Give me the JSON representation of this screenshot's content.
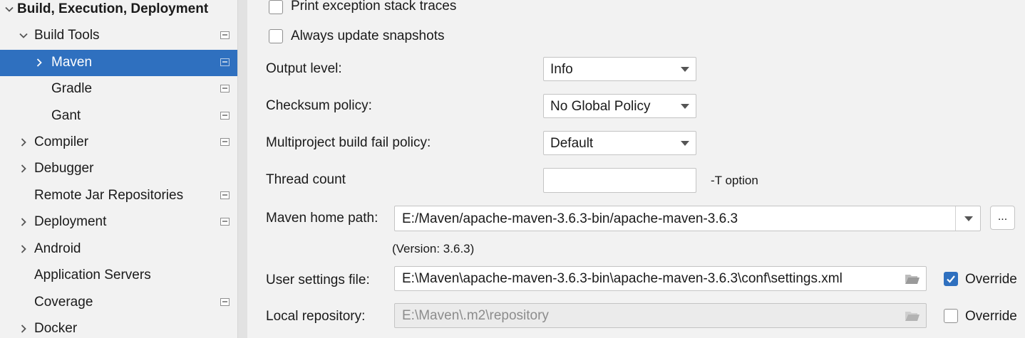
{
  "sidebar": {
    "items": [
      {
        "label": "Build, Execution, Deployment",
        "arrow": "down"
      },
      {
        "label": "Build Tools",
        "arrow": "down"
      },
      {
        "label": "Maven",
        "arrow": "right"
      },
      {
        "label": "Gradle",
        "arrow": ""
      },
      {
        "label": "Gant",
        "arrow": ""
      },
      {
        "label": "Compiler",
        "arrow": "right"
      },
      {
        "label": "Debugger",
        "arrow": "right"
      },
      {
        "label": "Remote Jar Repositories",
        "arrow": ""
      },
      {
        "label": "Deployment",
        "arrow": "right"
      },
      {
        "label": "Android",
        "arrow": "right"
      },
      {
        "label": "Application Servers",
        "arrow": ""
      },
      {
        "label": "Coverage",
        "arrow": ""
      },
      {
        "label": "Docker",
        "arrow": "right"
      }
    ],
    "selected": "Maven"
  },
  "options": {
    "print_exception": {
      "label": "Print exception stack traces",
      "checked": false
    },
    "always_update": {
      "label": "Always update snapshots",
      "checked": false
    }
  },
  "output_level": {
    "label": "Output level:",
    "value": "Info"
  },
  "checksum_policy": {
    "label": "Checksum policy:",
    "value": "No Global Policy"
  },
  "multiproject_policy": {
    "label": "Multiproject build fail policy:",
    "value": "Default"
  },
  "thread_count": {
    "label": "Thread count",
    "value": "",
    "hint": "-T option"
  },
  "maven_home": {
    "label": "Maven home path:",
    "value": "E:/Maven/apache-maven-3.6.3-bin/apache-maven-3.6.3",
    "version": "(Version: 3.6.3)",
    "browse_label": "..."
  },
  "user_settings": {
    "label": "User settings file:",
    "value": "E:\\Maven\\apache-maven-3.6.3-bin\\apache-maven-3.6.3\\conf\\settings.xml",
    "override_label": "Override",
    "override_checked": true
  },
  "local_repo": {
    "label": "Local repository:",
    "value": "E:\\Maven\\.m2\\repository",
    "override_label": "Override",
    "override_checked": false
  },
  "colors": {
    "selection": "#2f70bf",
    "checkbox_checked": "#2f70bf"
  }
}
